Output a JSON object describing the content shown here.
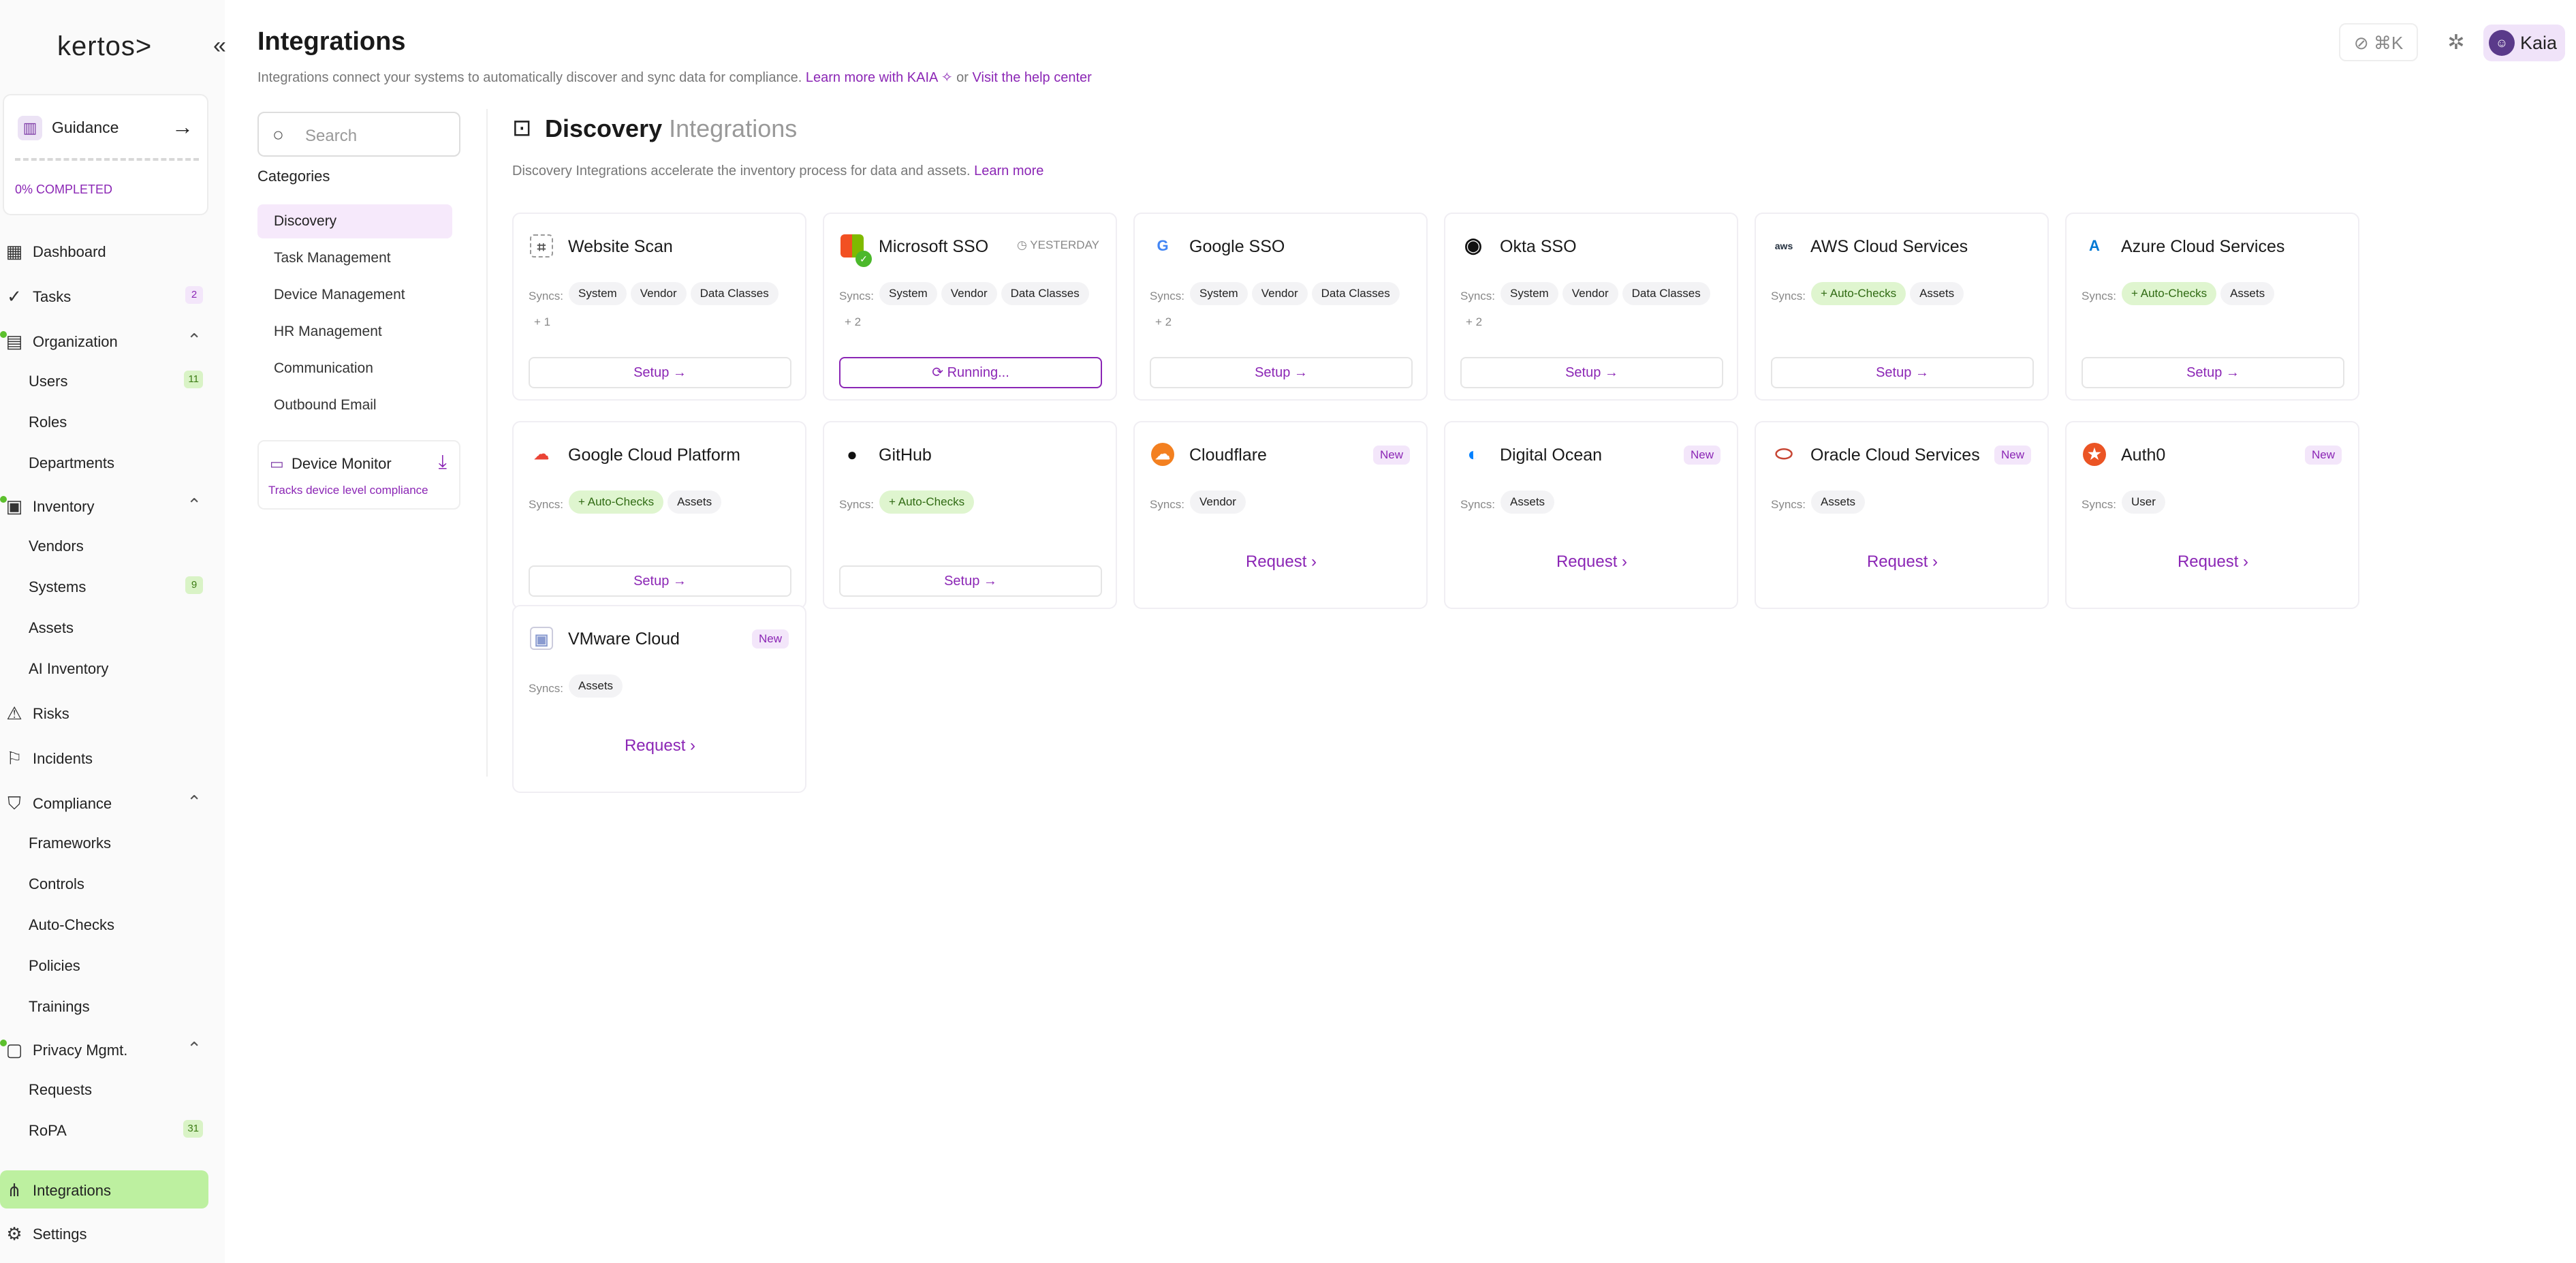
{
  "sidebar": {
    "logo": "kertos>",
    "collapse_icon": "«",
    "guidance": {
      "label": "Guidance",
      "progress": "0% COMPLETED",
      "progress_value": 0
    },
    "items": [
      {
        "label": "Dashboard"
      },
      {
        "label": "Tasks",
        "badge": "2"
      },
      {
        "label": "Organization"
      },
      {
        "label": "Users",
        "badge": "11"
      },
      {
        "label": "Roles"
      },
      {
        "label": "Departments"
      },
      {
        "label": "Inventory"
      },
      {
        "label": "Vendors"
      },
      {
        "label": "Systems",
        "badge": "9"
      },
      {
        "label": "Assets"
      },
      {
        "label": "AI Inventory"
      },
      {
        "label": "Risks"
      },
      {
        "label": "Incidents"
      },
      {
        "label": "Compliance"
      },
      {
        "label": "Frameworks"
      },
      {
        "label": "Controls"
      },
      {
        "label": "Auto-Checks"
      },
      {
        "label": "Policies"
      },
      {
        "label": "Trainings"
      },
      {
        "label": "Privacy Mgmt."
      },
      {
        "label": "Requests"
      },
      {
        "label": "RoPA",
        "badge": "31"
      },
      {
        "label": "Integrations"
      },
      {
        "label": "Settings"
      }
    ]
  },
  "header": {
    "title": "Integrations",
    "subtitle": "Integrations connect your systems to automatically discover and sync data for compliance.",
    "learn_kaia": "Learn more with KAIA",
    "or": "or",
    "help_center": "Visit the help center",
    "shortcut": "⌘K",
    "user_name": "Kaia"
  },
  "categories": {
    "search_placeholder": "Search",
    "heading": "Categories",
    "items": [
      "Discovery",
      "Task Management",
      "Device Management",
      "HR Management",
      "Communication",
      "Outbound Email"
    ],
    "device_monitor": {
      "title": "Device Monitor",
      "subtitle": "Tracks device level compliance"
    }
  },
  "section": {
    "title_bold": "Discovery",
    "title_light": "Integrations",
    "description": "Discovery Integrations accelerate the inventory process for data and assets.",
    "learn_more": "Learn more"
  },
  "common": {
    "syncs_label": "Syncs:",
    "setup": "Setup",
    "request": "Request",
    "running": "Running...",
    "new_badge": "New"
  },
  "cards": [
    {
      "name": "Website Scan",
      "tags": [
        "System",
        "Vendor",
        "Data Classes"
      ],
      "more": "+ 1",
      "action": "Setup"
    },
    {
      "name": "Microsoft SSO",
      "time": "YESTERDAY",
      "tags": [
        "System",
        "Vendor",
        "Data Classes"
      ],
      "more": "+ 2",
      "action": "Running..."
    },
    {
      "name": "Google SSO",
      "tags": [
        "System",
        "Vendor",
        "Data Classes"
      ],
      "more": "+ 2",
      "action": "Setup"
    },
    {
      "name": "Okta SSO",
      "tags": [
        "System",
        "Vendor",
        "Data Classes"
      ],
      "more": "+ 2",
      "action": "Setup"
    },
    {
      "name": "AWS Cloud Services",
      "tags": [
        "Auto-Checks",
        "Assets"
      ],
      "action": "Setup"
    },
    {
      "name": "Azure Cloud Services",
      "tags": [
        "Auto-Checks",
        "Assets"
      ],
      "action": "Setup"
    },
    {
      "name": "Google Cloud Platform",
      "tags": [
        "Auto-Checks",
        "Assets"
      ],
      "action": "Setup"
    },
    {
      "name": "GitHub",
      "tags": [
        "Auto-Checks"
      ],
      "action": "Setup"
    },
    {
      "name": "Cloudflare",
      "tags": [
        "Vendor"
      ],
      "action": "Request"
    },
    {
      "name": "Digital Ocean",
      "tags": [
        "Assets"
      ],
      "action": "Request"
    },
    {
      "name": "Oracle Cloud Services",
      "tags": [
        "Assets"
      ],
      "action": "Request"
    },
    {
      "name": "Auth0",
      "tags": [
        "User"
      ],
      "action": "Request"
    },
    {
      "name": "VMware Cloud",
      "tags": [
        "Assets"
      ],
      "action": "Request"
    }
  ],
  "colors": {
    "accent": "#8b26b5",
    "active_nav": "#bdf0a0",
    "green_tag": "#dff5cf"
  }
}
